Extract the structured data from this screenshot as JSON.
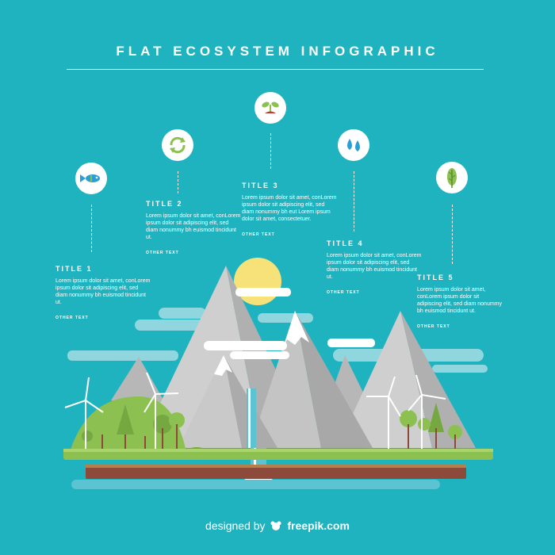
{
  "header": {
    "title": "FLAT ECOSYSTEM INFOGRAPHIC"
  },
  "items": [
    {
      "title": "TITLE 1",
      "text": "Lorem ipsum dolor sit amet, conLorem ipsum dolor sit adipiscing elit, sed diam nonummy bh euismod tincidunt ut.",
      "other": "OTHER TEXT",
      "icon": "fish-icon"
    },
    {
      "title": "TITLE 2",
      "text": "Lorem ipsum dolor sit amet, conLorem ipsum dolor sit adipiscing elit, sed diam nonummy bh euismod tincidunt ut.",
      "other": "OTHER TEXT",
      "icon": "recycle-icon"
    },
    {
      "title": "TITLE 3",
      "text": "Lorem ipsum dolor sit amet, conLorem ipsum dolor sit adipiscing elit, sed diam nonummy bh eut Lorem ipsum dolor sit amet, consectetuer.",
      "other": "OTHER TEXT",
      "icon": "sprout-icon"
    },
    {
      "title": "TITLE 4",
      "text": "Lorem ipsum dolor sit amet, conLorem ipsum dolor sit adipiscing elit, sed diam nonummy bh euismod tincidunt ut.",
      "other": "OTHER TEXT",
      "icon": "water-drops-icon"
    },
    {
      "title": "TITLE 5",
      "text": "Lorem ipsum dolor sit amet, conLorem ipsum dolor sit adipiscing elit, sed diam nonummy bh euismod tincidunt ut.",
      "other": "OTHER TEXT",
      "icon": "leaf-icon"
    }
  ],
  "footer": {
    "prefix": "designed by",
    "brand": "freepik.com",
    "logo_icon": "freepik-logo-icon"
  },
  "colors": {
    "background": "#1fb3bf",
    "mountain_light": "#c9c9c9",
    "mountain_dark": "#a8a8a8",
    "sun": "#f7e27a",
    "grass": "#8cc152",
    "soil": "#8d4a3a",
    "water": "#5bc3d1",
    "icon_green": "#8cc152",
    "icon_blue": "#2a9fd6"
  }
}
